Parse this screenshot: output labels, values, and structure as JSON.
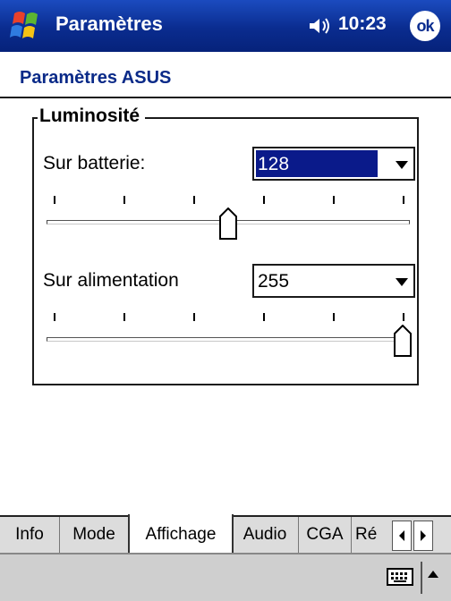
{
  "titlebar": {
    "title": "Paramètres",
    "time": "10:23",
    "ok_label": "ok"
  },
  "header": {
    "title": "Paramètres ASUS"
  },
  "brightness": {
    "group_label": "Luminosité",
    "battery": {
      "label": "Sur batterie:",
      "value": "128",
      "level": 0.5
    },
    "power": {
      "label": "Sur alimentation",
      "value": "255",
      "level": 1.0
    }
  },
  "tabs": [
    {
      "label": "Info"
    },
    {
      "label": "Mode"
    },
    {
      "label": "Affichage",
      "active": true
    },
    {
      "label": "Audio"
    },
    {
      "label": "CGA"
    },
    {
      "label": "Ré"
    }
  ],
  "colors": {
    "titlebar": "#0b2f95",
    "selection": "#0a1a8a",
    "header_text": "#0a2a88"
  }
}
